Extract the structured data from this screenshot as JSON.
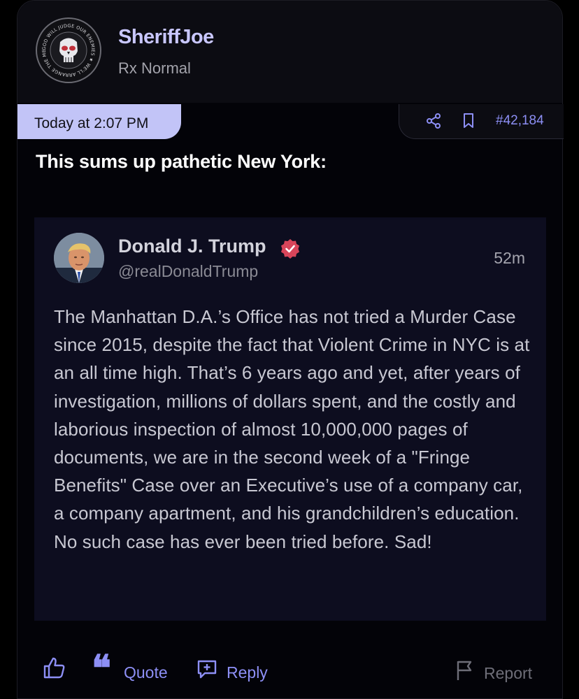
{
  "colors": {
    "accent": "#8d8ff5",
    "username": "#c9c7ff",
    "date_pill_bg": "#c2c4f7",
    "verified": "#d8455a",
    "background": "#000000"
  },
  "user": {
    "name": "SheriffJoe",
    "title": "Rx Normal",
    "avatar_icon": "punisher-skull-icon",
    "avatar_ring_text": "GOD WILL JUDGE OUR ENEMIES ★ WE'LL ARRANGE THE MEETING ★"
  },
  "post": {
    "date": "Today at 2:07 PM",
    "number": "#42,184",
    "text": "This sums up pathetic New York:"
  },
  "embed": {
    "author": "Donald J. Trump",
    "handle": "@realDonaldTrump",
    "time": "52m",
    "verified_icon": "verified-badge-icon",
    "body": "The Manhattan D.A.’s Office has not tried a Murder Case since 2015, despite the fact that Violent Crime in NYC is at an all time high. That’s 6 years ago and yet, after years of investigation, millions of dollars spent, and the costly and laborious inspection of almost 10,000,000 pages of documents, we are in the second week of a \"Fringe Benefits\" Case over an Executive’s use of a company car, a company apartment, and his grandchildren’s education. No such case has ever been tried before. Sad!"
  },
  "actions": {
    "share_icon": "share-icon",
    "bookmark_icon": "bookmark-icon",
    "like_icon": "thumbs-up-icon",
    "quote_glyph": "❝",
    "quote_label": "Quote",
    "reply_icon": "reply-icon",
    "reply_label": "Reply",
    "report_icon": "flag-icon",
    "report_label": "Report"
  }
}
